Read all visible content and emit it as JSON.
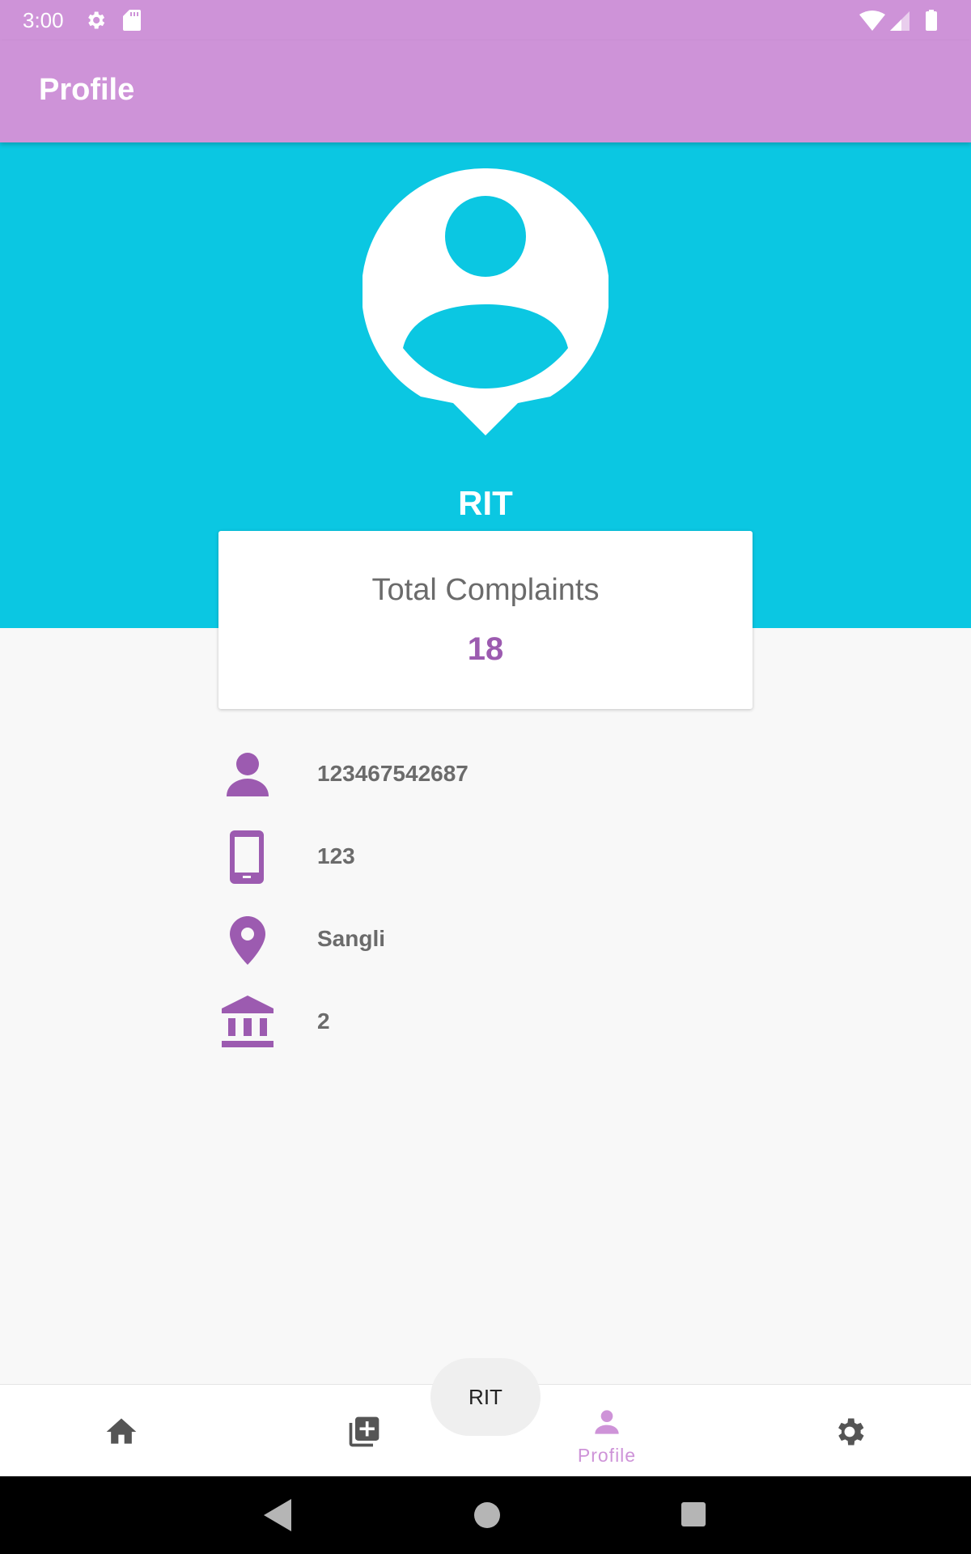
{
  "status_bar": {
    "time": "3:00",
    "icons": [
      "gear-icon",
      "sd-card-icon",
      "wifi-icon",
      "signal-icon",
      "battery-icon"
    ]
  },
  "app_bar": {
    "title": "Profile"
  },
  "profile": {
    "name": "RIT",
    "avatar_icon": "account-pin-icon"
  },
  "stats": {
    "label": "Total Complaints",
    "value": "18"
  },
  "info_rows": [
    {
      "icon": "person-icon",
      "value": "123467542687"
    },
    {
      "icon": "phone-icon",
      "value": "123"
    },
    {
      "icon": "location-pin-icon",
      "value": "Sangli"
    },
    {
      "icon": "institution-icon",
      "value": "2"
    }
  ],
  "bottom_nav": {
    "items": [
      {
        "icon": "home-icon",
        "label": ""
      },
      {
        "icon": "add-library-icon",
        "label": ""
      },
      {
        "icon": "person-icon",
        "label": "Profile",
        "active": true
      },
      {
        "icon": "settings-icon",
        "label": ""
      }
    ]
  },
  "toast": {
    "text": "RIT"
  },
  "colors": {
    "app_bar": "#ce93d8",
    "hero": "#0bc7e2",
    "accent": "#9c5bb0",
    "text_secondary": "#6b6b6b"
  }
}
